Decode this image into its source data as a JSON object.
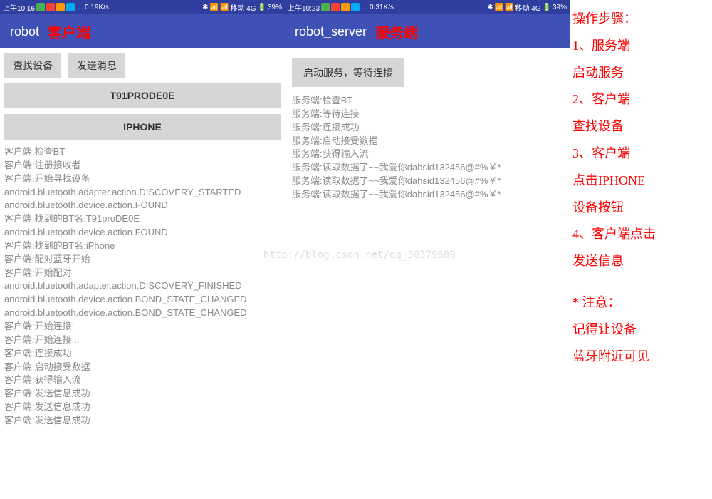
{
  "client": {
    "statusbar": {
      "time": "上午10:16",
      "speed": "0.19K/s",
      "net": "移动 4G",
      "battery": "39%"
    },
    "title": "robot",
    "label": "客户端",
    "buttons": {
      "find": "查找设备",
      "send": "发送消息"
    },
    "devices": {
      "d1": "T91PRODE0E",
      "d2": "IPHONE"
    },
    "logs": [
      "客户端:检查BT",
      "客户端:注册接收者",
      "客户端:开始寻找设备",
      "android.bluetooth.adapter.action.DISCOVERY_STARTED",
      "android.bluetooth.device.action.FOUND",
      "客户端:找到的BT名:T91proDE0E",
      "android.bluetooth.device.action.FOUND",
      "客户端:找到的BT名:iPhone",
      "客户端:配对蓝牙开始",
      "客户端:开始配对",
      "android.bluetooth.adapter.action.DISCOVERY_FINISHED",
      "android.bluetooth.device.action.BOND_STATE_CHANGED",
      "android.bluetooth.device.action.BOND_STATE_CHANGED",
      "客户端:开始连接:",
      "客户端:开始连接...",
      "客户端:连接成功",
      "客户端:启动接受数据",
      "客户端:获得输入流",
      "客户端:发送信息成功",
      "客户端:发送信息成功",
      "客户端:发送信息成功"
    ]
  },
  "server": {
    "statusbar": {
      "time": "上午10:23",
      "speed": "0.31K/s",
      "net": "移动 4G",
      "battery": "39%"
    },
    "title": "robot_server",
    "label": "服务端",
    "button": "启动服务，等待连接",
    "logs": [
      "服务端:检查BT",
      "服务端:等待连接",
      "服务端:连接成功",
      "服务端:启动接受数据",
      "服务端:获得输入流",
      "服务端:读取数据了~~我爱你dahsid132456@#%￥*",
      "服务端:读取数据了~~我爱你dahsid132456@#%￥*",
      "服务端:读取数据了~~我爱你dahsid132456@#%￥*"
    ]
  },
  "instructions": {
    "title": "操作步骤：",
    "steps": [
      "1、服务端",
      "启动服务",
      "2、客户端",
      "查找设备",
      "3、客户端",
      "点击IPHONE",
      "设备按钮",
      "4、客户端点击",
      "发送信息"
    ],
    "note_title": "* 注意：",
    "note1": "记得让设备",
    "note2": "蓝牙附近可见"
  },
  "watermark": "http://blog.csdn.net/qq_30379689"
}
